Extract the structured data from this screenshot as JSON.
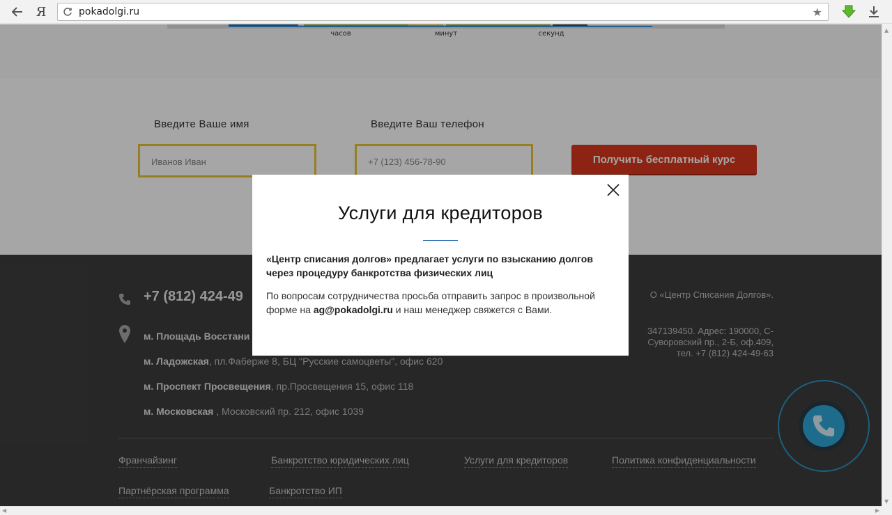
{
  "browser": {
    "ya_label": "Я",
    "url": "pokadolgi.ru"
  },
  "timer": {
    "labels": [
      "часов",
      "минут",
      "секунд"
    ]
  },
  "form": {
    "name_label": "Введите Ваше имя",
    "name_placeholder": "Иванов Иван",
    "phone_label": "Введите Ваш телефон",
    "phone_placeholder": "+7 (123) 456-78-90",
    "submit_label": "Получить бесплатный курс"
  },
  "footer": {
    "phone": "+7 (812) 424-49",
    "addresses": [
      {
        "metro": "м. Площадь Восстани",
        "text": ""
      },
      {
        "metro": "м. Ладожская",
        "text": ", пл.Фаберже 8, БЦ \"Русские самоцветы\", офис 620"
      },
      {
        "metro": "м. Проспект Просвещения",
        "text": ", пр.Просвещения 15, офис 118"
      },
      {
        "metro": "м. Московская",
        "text": " , Московский пр. 212, офис 1039"
      }
    ],
    "legal_line1": "О «Центр Списания Долгов».",
    "legal_line2": "347139450. Адрес: 190000, С-",
    "legal_line3": "Суворовский пр., 2-Б, оф.409,",
    "legal_line4": "тел. +7 (812) 424-49-63",
    "links": [
      "Франчайзинг",
      "Банкротство юридических лиц",
      "Услуги для кредиторов",
      "Политика конфиденциальности",
      "Партнёрская программа",
      "Банкротство ИП"
    ]
  },
  "modal": {
    "title": "Услуги для кредиторов",
    "lead": "«Центр списания долгов» предлагает услуги по взысканию долгов через процедуру банкротства физических лиц",
    "body_before": "По вопросам сотрудничества просьба отправить запрос в произвольной форме на ",
    "email": "ag@pokadolgi.ru",
    "body_after": " и наш менеджер свяжется с Вами."
  },
  "icons": {
    "back": "arrow-left-icon",
    "reload": "reload-icon",
    "bookmark": "star-icon",
    "extension": "green-download-arrow-icon",
    "download": "download-icon",
    "phone": "phone-icon",
    "location": "map-pin-icon",
    "close": "close-icon",
    "call": "phone-handset-icon"
  },
  "colors": {
    "accent_button": "#d9361d",
    "input_border": "#e8c230",
    "footer_bg": "#3d3d3d",
    "call_widget": "#2fa7d8",
    "modal_underline": "#2d6fb3"
  }
}
